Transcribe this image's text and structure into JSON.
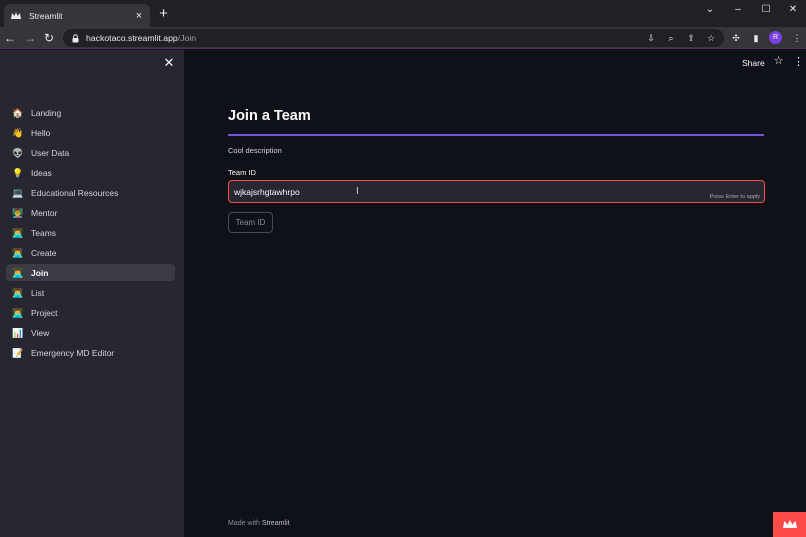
{
  "browser": {
    "tab_title": "Streamlit",
    "url_host": "hackotaco.streamlit.app",
    "url_path": "/Join",
    "avatar_initial": "R"
  },
  "sidebar": {
    "items": [
      {
        "emoji": "🏠",
        "label": "Landing"
      },
      {
        "emoji": "👋",
        "label": "Hello"
      },
      {
        "emoji": "👽",
        "label": "User Data"
      },
      {
        "emoji": "💡",
        "label": "Ideas"
      },
      {
        "emoji": "💻",
        "label": "Educational Resources"
      },
      {
        "emoji": "👨‍🏫",
        "label": "Mentor"
      },
      {
        "emoji": "👨‍💻",
        "label": "Teams"
      },
      {
        "emoji": "👨‍💻",
        "label": "Create"
      },
      {
        "emoji": "👨‍💻",
        "label": "Join"
      },
      {
        "emoji": "👨‍💻",
        "label": "List"
      },
      {
        "emoji": "👨‍💻",
        "label": "Project"
      },
      {
        "emoji": "📊",
        "label": "View"
      },
      {
        "emoji": "📝",
        "label": "Emergency MD Editor"
      }
    ]
  },
  "header": {
    "share_label": "Share"
  },
  "main": {
    "title": "Join a Team",
    "description": "Cool description",
    "field_label": "Team ID",
    "input_value": "wjkajsrhgtawhrpo",
    "input_hint": "Press Enter to apply",
    "button_label": "Team ID"
  },
  "footer": {
    "prefix": "Made with ",
    "brand": "Streamlit"
  },
  "colors": {
    "accent": "#7d53de",
    "error_border": "#ff4b4b",
    "sidebar_bg": "#262730",
    "main_bg": "#0e1117"
  }
}
